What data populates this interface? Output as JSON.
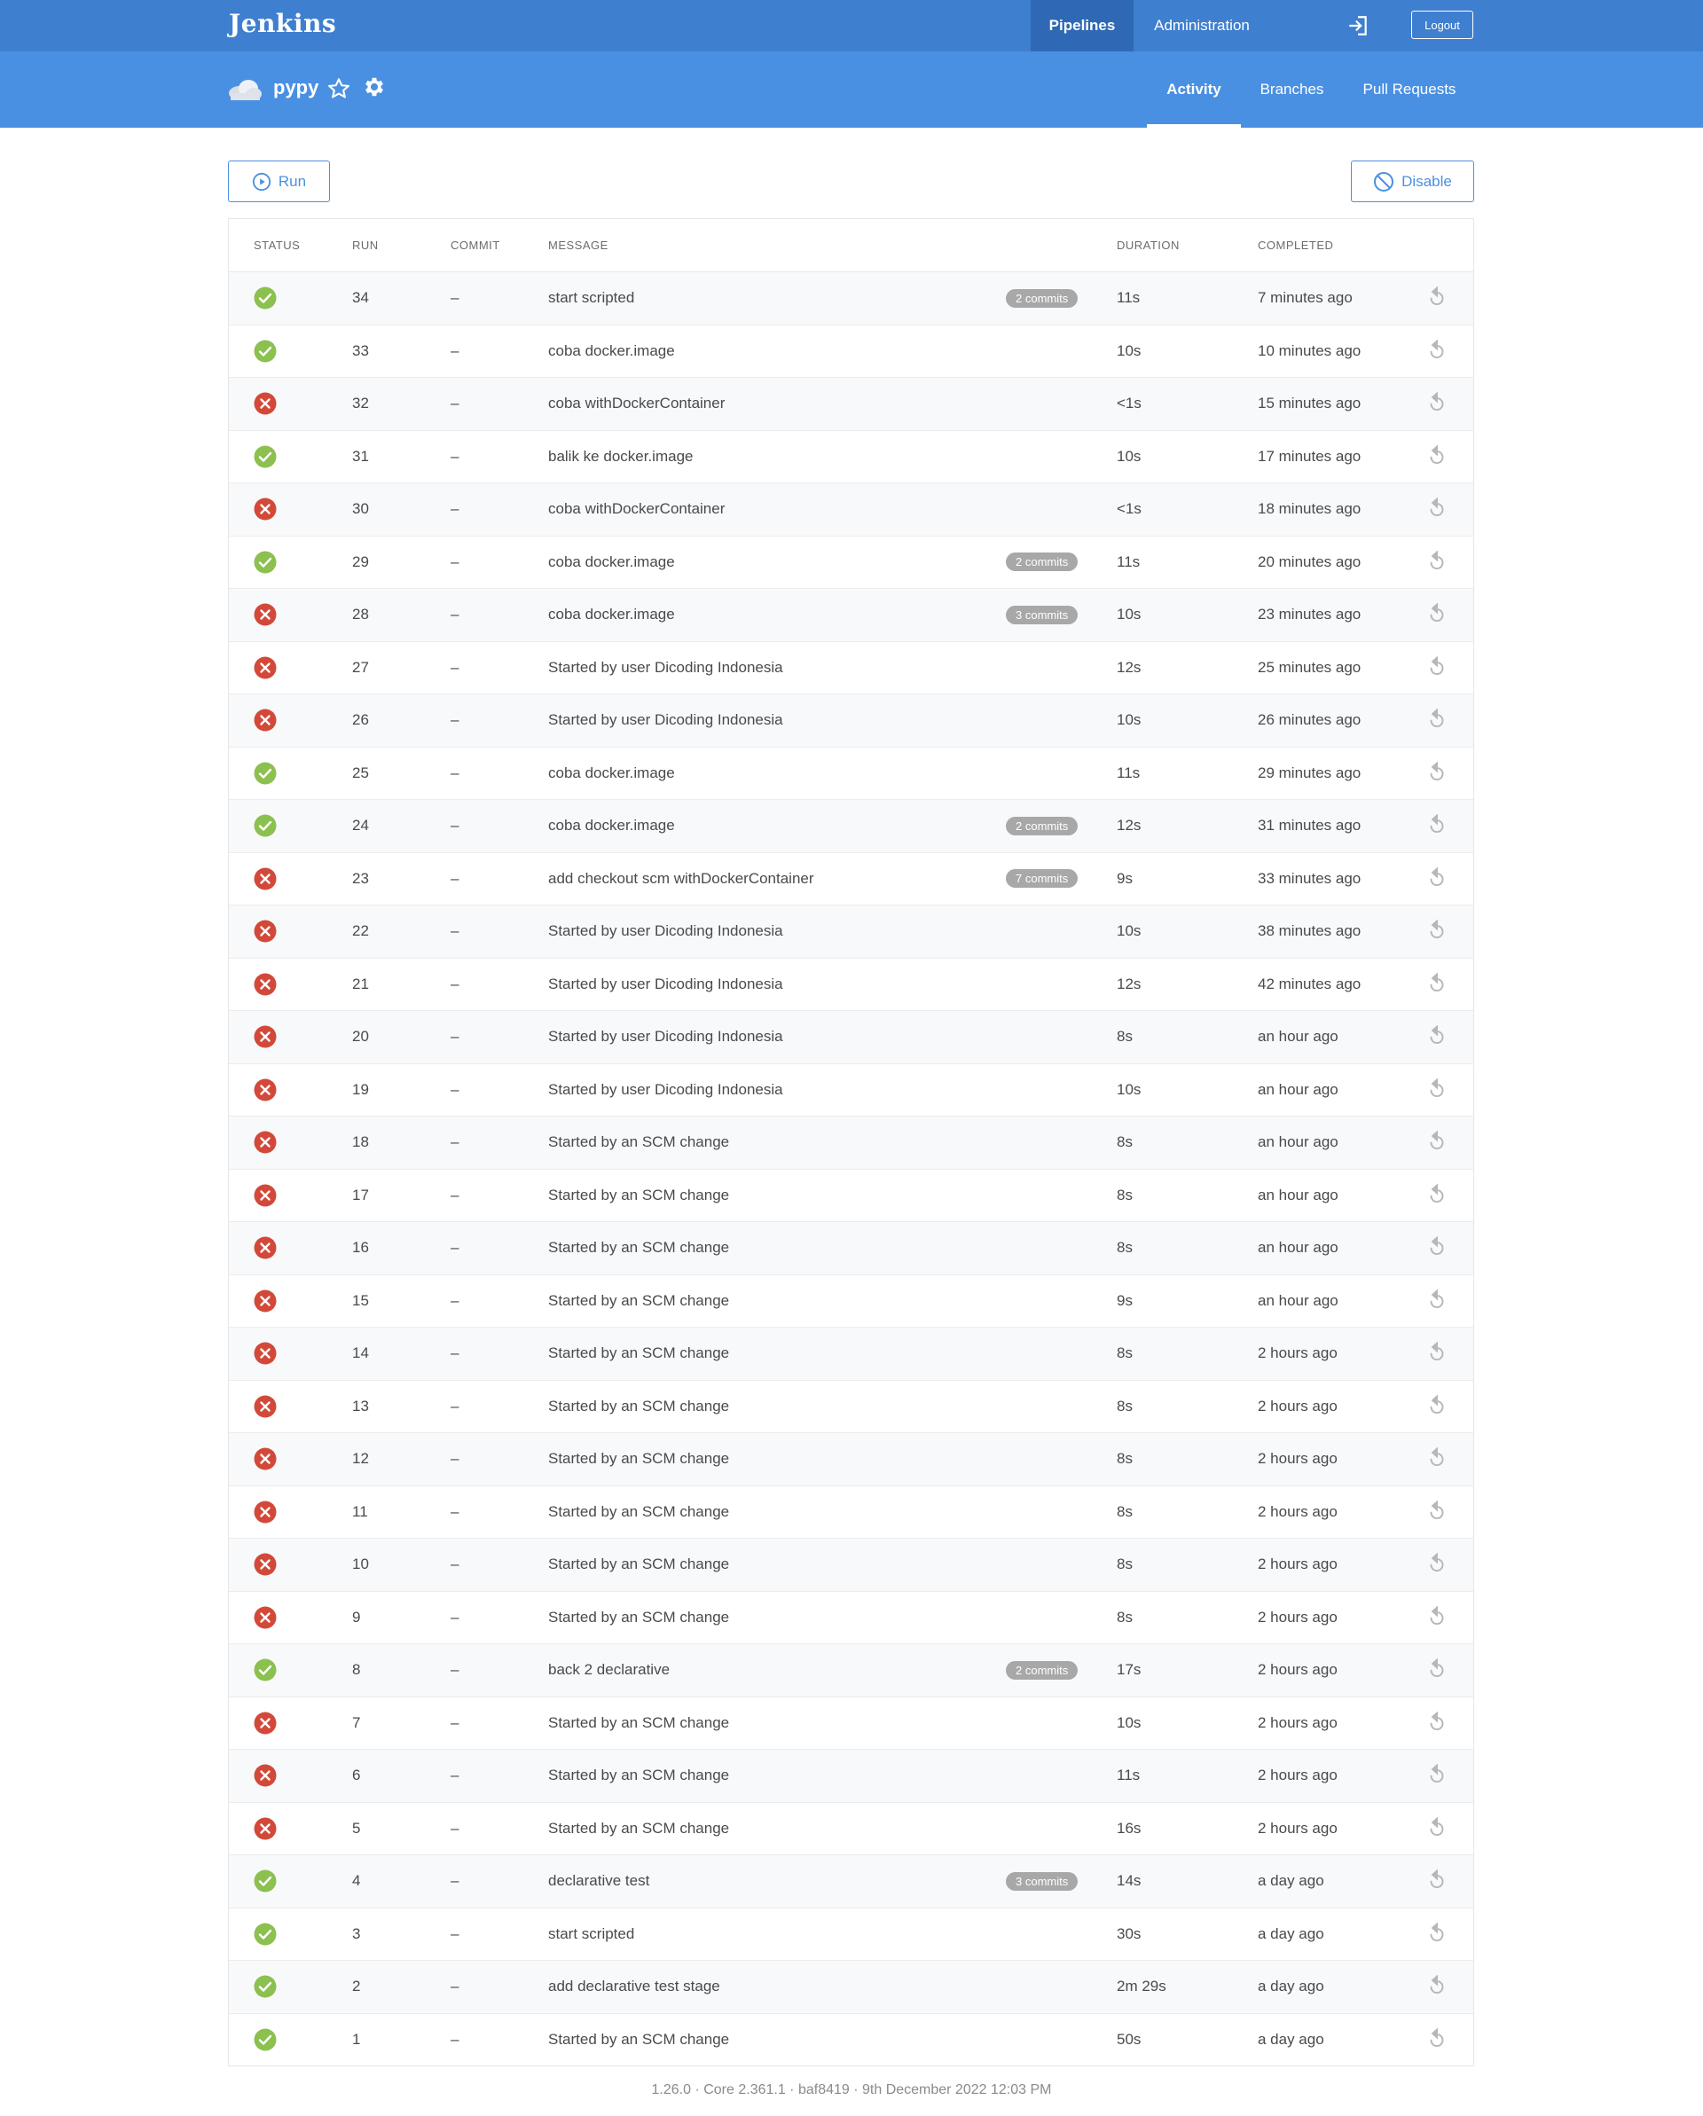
{
  "header": {
    "logo": "Jenkins",
    "nav": {
      "pipelines": "Pipelines",
      "administration": "Administration"
    },
    "logout_label": "Logout"
  },
  "pipeline": {
    "name": "pypy",
    "tabs": {
      "activity": "Activity",
      "branches": "Branches",
      "pull_requests": "Pull Requests"
    }
  },
  "actions": {
    "run_label": "Run",
    "disable_label": "Disable"
  },
  "colors": {
    "success": "#8cc04f",
    "failure": "#d24939",
    "accent": "#4a90e2",
    "topbar": "#3f7fcf"
  },
  "table": {
    "headers": {
      "status": "STATUS",
      "run": "RUN",
      "commit": "COMMIT",
      "message": "MESSAGE",
      "duration": "DURATION",
      "completed": "COMPLETED"
    },
    "rows": [
      {
        "status": "success",
        "run": "34",
        "commit": "–",
        "message": "start scripted",
        "badge": "2 commits",
        "duration": "11s",
        "completed": "7 minutes ago"
      },
      {
        "status": "success",
        "run": "33",
        "commit": "–",
        "message": "coba docker.image",
        "badge": "",
        "duration": "10s",
        "completed": "10 minutes ago"
      },
      {
        "status": "failure",
        "run": "32",
        "commit": "–",
        "message": "coba withDockerContainer",
        "badge": "",
        "duration": "<1s",
        "completed": "15 minutes ago"
      },
      {
        "status": "success",
        "run": "31",
        "commit": "–",
        "message": "balik ke docker.image",
        "badge": "",
        "duration": "10s",
        "completed": "17 minutes ago"
      },
      {
        "status": "failure",
        "run": "30",
        "commit": "–",
        "message": "coba withDockerContainer",
        "badge": "",
        "duration": "<1s",
        "completed": "18 minutes ago"
      },
      {
        "status": "success",
        "run": "29",
        "commit": "–",
        "message": "coba docker.image",
        "badge": "2 commits",
        "duration": "11s",
        "completed": "20 minutes ago"
      },
      {
        "status": "failure",
        "run": "28",
        "commit": "–",
        "message": "coba docker.image",
        "badge": "3 commits",
        "duration": "10s",
        "completed": "23 minutes ago"
      },
      {
        "status": "failure",
        "run": "27",
        "commit": "–",
        "message": "Started by user Dicoding Indonesia",
        "badge": "",
        "duration": "12s",
        "completed": "25 minutes ago"
      },
      {
        "status": "failure",
        "run": "26",
        "commit": "–",
        "message": "Started by user Dicoding Indonesia",
        "badge": "",
        "duration": "10s",
        "completed": "26 minutes ago"
      },
      {
        "status": "success",
        "run": "25",
        "commit": "–",
        "message": "coba docker.image",
        "badge": "",
        "duration": "11s",
        "completed": "29 minutes ago"
      },
      {
        "status": "success",
        "run": "24",
        "commit": "–",
        "message": "coba docker.image",
        "badge": "2 commits",
        "duration": "12s",
        "completed": "31 minutes ago"
      },
      {
        "status": "failure",
        "run": "23",
        "commit": "–",
        "message": "add checkout scm withDockerContainer",
        "badge": "7 commits",
        "duration": "9s",
        "completed": "33 minutes ago"
      },
      {
        "status": "failure",
        "run": "22",
        "commit": "–",
        "message": "Started by user Dicoding Indonesia",
        "badge": "",
        "duration": "10s",
        "completed": "38 minutes ago"
      },
      {
        "status": "failure",
        "run": "21",
        "commit": "–",
        "message": "Started by user Dicoding Indonesia",
        "badge": "",
        "duration": "12s",
        "completed": "42 minutes ago"
      },
      {
        "status": "failure",
        "run": "20",
        "commit": "–",
        "message": "Started by user Dicoding Indonesia",
        "badge": "",
        "duration": "8s",
        "completed": "an hour ago"
      },
      {
        "status": "failure",
        "run": "19",
        "commit": "–",
        "message": "Started by user Dicoding Indonesia",
        "badge": "",
        "duration": "10s",
        "completed": "an hour ago"
      },
      {
        "status": "failure",
        "run": "18",
        "commit": "–",
        "message": "Started by an SCM change",
        "badge": "",
        "duration": "8s",
        "completed": "an hour ago"
      },
      {
        "status": "failure",
        "run": "17",
        "commit": "–",
        "message": "Started by an SCM change",
        "badge": "",
        "duration": "8s",
        "completed": "an hour ago"
      },
      {
        "status": "failure",
        "run": "16",
        "commit": "–",
        "message": "Started by an SCM change",
        "badge": "",
        "duration": "8s",
        "completed": "an hour ago"
      },
      {
        "status": "failure",
        "run": "15",
        "commit": "–",
        "message": "Started by an SCM change",
        "badge": "",
        "duration": "9s",
        "completed": "an hour ago"
      },
      {
        "status": "failure",
        "run": "14",
        "commit": "–",
        "message": "Started by an SCM change",
        "badge": "",
        "duration": "8s",
        "completed": "2 hours ago"
      },
      {
        "status": "failure",
        "run": "13",
        "commit": "–",
        "message": "Started by an SCM change",
        "badge": "",
        "duration": "8s",
        "completed": "2 hours ago"
      },
      {
        "status": "failure",
        "run": "12",
        "commit": "–",
        "message": "Started by an SCM change",
        "badge": "",
        "duration": "8s",
        "completed": "2 hours ago"
      },
      {
        "status": "failure",
        "run": "11",
        "commit": "–",
        "message": "Started by an SCM change",
        "badge": "",
        "duration": "8s",
        "completed": "2 hours ago"
      },
      {
        "status": "failure",
        "run": "10",
        "commit": "–",
        "message": "Started by an SCM change",
        "badge": "",
        "duration": "8s",
        "completed": "2 hours ago"
      },
      {
        "status": "failure",
        "run": "9",
        "commit": "–",
        "message": "Started by an SCM change",
        "badge": "",
        "duration": "8s",
        "completed": "2 hours ago"
      },
      {
        "status": "success",
        "run": "8",
        "commit": "–",
        "message": "back 2 declarative",
        "badge": "2 commits",
        "duration": "17s",
        "completed": "2 hours ago"
      },
      {
        "status": "failure",
        "run": "7",
        "commit": "–",
        "message": "Started by an SCM change",
        "badge": "",
        "duration": "10s",
        "completed": "2 hours ago"
      },
      {
        "status": "failure",
        "run": "6",
        "commit": "–",
        "message": "Started by an SCM change",
        "badge": "",
        "duration": "11s",
        "completed": "2 hours ago"
      },
      {
        "status": "failure",
        "run": "5",
        "commit": "–",
        "message": "Started by an SCM change",
        "badge": "",
        "duration": "16s",
        "completed": "2 hours ago"
      },
      {
        "status": "success",
        "run": "4",
        "commit": "–",
        "message": "declarative test",
        "badge": "3 commits",
        "duration": "14s",
        "completed": "a day ago"
      },
      {
        "status": "success",
        "run": "3",
        "commit": "–",
        "message": "start scripted",
        "badge": "",
        "duration": "30s",
        "completed": "a day ago"
      },
      {
        "status": "success",
        "run": "2",
        "commit": "–",
        "message": "add declarative test stage",
        "badge": "",
        "duration": "2m 29s",
        "completed": "a day ago"
      },
      {
        "status": "success",
        "run": "1",
        "commit": "–",
        "message": "Started by an SCM change",
        "badge": "",
        "duration": "50s",
        "completed": "a day ago"
      }
    ]
  },
  "footer": "1.26.0 · Core 2.361.1 · baf8419 · 9th December 2022 12:03 PM"
}
